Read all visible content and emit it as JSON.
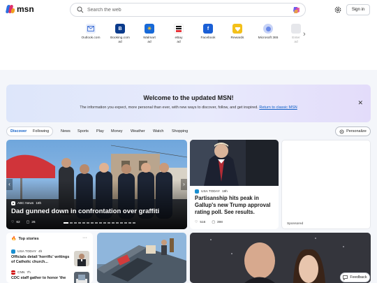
{
  "brand": {
    "logo_text": "msn",
    "colors": {
      "accent": "#0f5fc7",
      "banner_start": "#dde6fa",
      "banner_end": "#e3dcfa"
    }
  },
  "search": {
    "placeholder": "Search the web",
    "icon": "search-icon"
  },
  "header": {
    "sign_in_label": "Sign in",
    "settings_icon": "gear-icon",
    "copilot_icon": "copilot-icon"
  },
  "quick_links": [
    {
      "label": "Outlook.com",
      "icon": "outlook-icon",
      "color": "#e8eefb"
    },
    {
      "label": "Booking.com\nad",
      "icon": "booking-icon",
      "color": "#0b3b8c"
    },
    {
      "label": "Walmart\nad",
      "icon": "walmart-icon",
      "color": "#1769d8"
    },
    {
      "label": "eBay\nad",
      "icon": "ebay-icon",
      "color": "#ffffff"
    },
    {
      "label": "Facebook",
      "icon": "facebook-icon",
      "color": "#1a5fd6"
    },
    {
      "label": "Rewards",
      "icon": "rewards-icon",
      "color": "#f3c01a"
    },
    {
      "label": "Microsoft 365",
      "icon": "m365-icon",
      "color": "#c7d3f6"
    },
    {
      "label": "Enter\nad",
      "icon": "extra-icon",
      "color": "#c9ccd4"
    }
  ],
  "banner": {
    "title": "Welcome to the updated MSN!",
    "text": "The information you expect, more personal than ever, with new ways to discover, follow, and get inspired.",
    "link": "Return to classic MSN",
    "close_icon": "close-icon"
  },
  "nav": {
    "items": [
      "Discover",
      "Following",
      "News",
      "Sports",
      "Play",
      "Money",
      "Weather",
      "Watch",
      "Shopping"
    ],
    "active": "Discover",
    "personalize_label": "Personalize"
  },
  "hero": {
    "source": "ABC News",
    "age": "18h",
    "title": "Dad gunned down in confrontation over graffiti",
    "likes": "62",
    "comments": "26"
  },
  "story2": {
    "source": "USA TODAY",
    "age": "19h",
    "title": "Partisanship hits peak in Gallup's new Trump approval rating poll. See results.",
    "likes": "516",
    "comments": "398"
  },
  "ad": {
    "label": "Sponsored"
  },
  "top_stories": {
    "heading": "Top stories",
    "more_label": "···",
    "items": [
      {
        "source": "USA TODAY",
        "age": "4h",
        "title": "Officials detail 'horrific' writings of Catholic church..."
      },
      {
        "source": "CNN",
        "age": "7h",
        "title": "CDC staff gather to honor 'the"
      }
    ]
  },
  "feedback": {
    "label": "Feedback"
  }
}
